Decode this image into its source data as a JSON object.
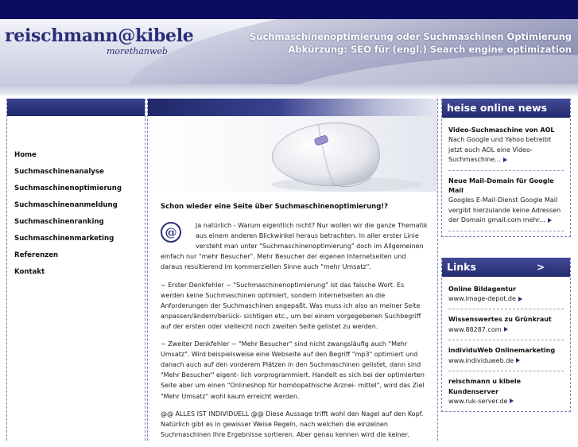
{
  "header": {
    "logo_text": "reischmann@kibele",
    "tagline": "morethanweb",
    "slogan_line1": "Suchmaschinenoptimierung oder Suchmaschinen Optimierung",
    "slogan_line2": "Abkürzung: SEO für (engl.) Search engine optimization"
  },
  "nav": {
    "items": [
      {
        "label": "Home"
      },
      {
        "label": "Suchmaschinenanalyse"
      },
      {
        "label": "Suchmaschinenoptimierung"
      },
      {
        "label": "Suchmaschinenanmeldung"
      },
      {
        "label": "Suchmaschinenranking"
      },
      {
        "label": "Suchmaschinenmarketing"
      },
      {
        "label": "Referenzen"
      },
      {
        "label": "Kontakt"
      }
    ]
  },
  "main": {
    "heading": "Schon wieder eine Seite über Suchmaschinenoptimierung!?",
    "at_logo": "@",
    "paragraphs": [
      "Ja natürlich - Warum eigentlich nicht? Nur wollen wir die ganze Thematik aus einem anderen Blickwinkel heraus betrachten. In aller erster Linie versteht man unter \"Suchmaschinenoptimierung\" doch im Allgemeinen einfach nur \"mehr Besucher\". Mehr Besucher der eigenen Internetseiten und daraus resultierend im kommerziellen Sinne auch \"mehr Umsatz\".",
      "~ Erster Denkfehler ~ \"Suchmaschinenoptimierung\" ist das falsche Wort. Es werden keine Suchmaschinen optimiert, sondern Internetseiten an die Anforderungen der Suchmaschinen angepaßt. Was muss ich also an meiner Seite anpassen/ändern/berück- sichtigen etc., um bei einem vorgegebenen Suchbegriff auf der ersten oder vielleicht noch zweiten Seite gelistet zu werden.",
      "~ Zweiter Denkfehler ~ \"Mehr Besucher\" sind nicht zwangsläufig auch \"Mehr Umsatz\". Wird beispielsweise eine Webseite auf den Begriff \"mp3\" optimiert und danach auch auf den vorderem Plätzen in den Suchmaschinen gelistet, dann sind \"Mehr Besucher\" eigent- lich vorprogrammiert. Handelt es sich bei der optimierten Seite aber um einen \"Onlineshop für homöopathische Arznei- mittel\", wird das Ziel \"Mehr Umsatz\" wohl kaum erreicht werden.",
      "@@ ALLES IST INDIVIDUELL @@ Diese Aussage trifft wohl den Nagel auf den Kopf. Natürlich gibt es in gewisser Weise Regeln, nach welchen die einzelnen Suchmaschinen Ihre Ergebnisse sortieren. Aber genau kennen wird die keiner."
    ]
  },
  "news": {
    "title": "heise online news",
    "items": [
      {
        "title": "Video-Suchmaschine von AOL",
        "text": "Nach Google und Yahoo betreibt jetzt auch AOL eine Video-Suchmaschine..."
      },
      {
        "title": "Neue Mail-Domain für Google Mail",
        "text": "Googles E-Mail-Dienst Google Mail vergibt hierzulande keine Adressen der Domain gmail.com mehr..."
      }
    ]
  },
  "links": {
    "title": "Links",
    "arrow": ">",
    "items": [
      {
        "title": "Online Bildagentur",
        "url": "www.image-depot.de"
      },
      {
        "title": "Wissenswertes zu Grünkraut",
        "url": "www.88287.com"
      },
      {
        "title": "individuWeb Onlinemarketing",
        "url": "www.individuweb.de"
      },
      {
        "title": "reischmann u kibele Kundenserver",
        "url": "www.ruk-server.de"
      }
    ]
  },
  "colors": {
    "dark_blue": "#0d0d60",
    "brand_blue": "#2a2f78",
    "box_header": "#2c3480"
  }
}
